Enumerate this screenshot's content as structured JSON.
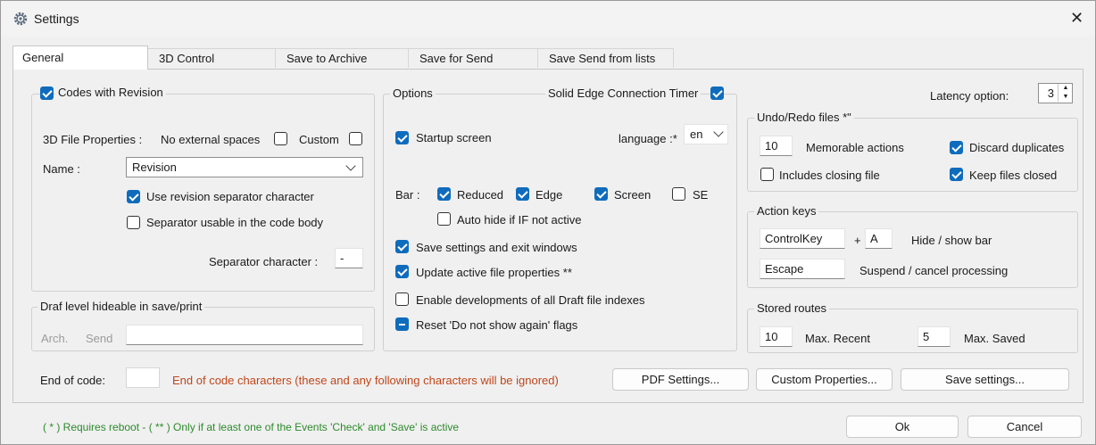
{
  "window": {
    "title": "Settings",
    "close_glyph": "✕",
    "icon": "gear-icon"
  },
  "tabs": [
    {
      "label": "General",
      "active": true
    },
    {
      "label": "3D Control",
      "active": false
    },
    {
      "label": "Save to Archive",
      "active": false
    },
    {
      "label": "Save for Send",
      "active": false
    },
    {
      "label": "Save Send from lists",
      "active": false
    }
  ],
  "codes": {
    "group_label": "Codes with Revision",
    "checked": true,
    "file_props_label": "3D File Properties :",
    "no_spaces_label": "No external spaces",
    "no_spaces_checked": false,
    "custom_label": "Custom",
    "custom_checked": false,
    "name_label": "Name :",
    "name_value": "Revision",
    "use_sep_label": "Use revision separator character",
    "use_sep_checked": true,
    "sep_usable_label": "Separator usable in the code body",
    "sep_usable_checked": false,
    "sep_char_label": "Separator character :",
    "sep_char_value": "-"
  },
  "draft": {
    "group_label": "Draf level hideable in save/print",
    "arch_label": "Arch.",
    "send_label": "Send",
    "value": ""
  },
  "options": {
    "group_label": "Options",
    "timer_label": "Solid Edge Connection Timer",
    "timer_checked": true,
    "startup_label": "Startup screen",
    "startup_checked": true,
    "language_label": "language :*",
    "language_value": "en",
    "bar_label": "Bar :",
    "reduced_label": "Reduced",
    "reduced_checked": true,
    "edge_label": "Edge",
    "edge_checked": true,
    "screen_label": "Screen",
    "screen_checked": true,
    "se_label": "SE",
    "se_checked": false,
    "autohide_label": "Auto hide if IF not active",
    "autohide_checked": false,
    "save_exit_label": "Save settings and exit windows",
    "save_exit_checked": true,
    "update_label": "Update active file properties **",
    "update_checked": true,
    "enable_dev_label": "Enable developments of all Draft file indexes",
    "enable_dev_checked": false,
    "reset_label": "Reset 'Do not show again' flags",
    "reset_state": "indeterminate"
  },
  "latency": {
    "label": "Latency option:",
    "value": "3"
  },
  "undo": {
    "group_label": "Undo/Redo files *\"",
    "memorable_value": "10",
    "memorable_label": "Memorable actions",
    "discard_label": "Discard duplicates",
    "discard_checked": true,
    "includes_label": "Includes closing file",
    "includes_checked": false,
    "keep_label": "Keep files closed",
    "keep_checked": true
  },
  "action_keys": {
    "group_label": "Action keys",
    "key1": "ControlKey",
    "plus": "+",
    "key2": "A",
    "hide_label": "Hide / show bar",
    "key3": "Escape",
    "suspend_label": "Suspend / cancel processing"
  },
  "routes": {
    "group_label": "Stored routes",
    "recent_value": "10",
    "recent_label": "Max. Recent",
    "saved_value": "5",
    "saved_label": "Max. Saved"
  },
  "end_code": {
    "label": "End of code:",
    "value": "",
    "note": "End of code characters (these and any following characters will be ignored)"
  },
  "buttons": {
    "pdf": "PDF Settings...",
    "custom_props": "Custom Properties...",
    "save_settings": "Save settings...",
    "ok": "Ok",
    "cancel": "Cancel"
  },
  "footer_note": "( * ) Requires reboot - ( ** ) Only if at least one of the Events 'Check' and 'Save' is active",
  "colors": {
    "accent": "#0f6cbd",
    "warning": "#c0461a",
    "note": "#2c8a2c"
  }
}
